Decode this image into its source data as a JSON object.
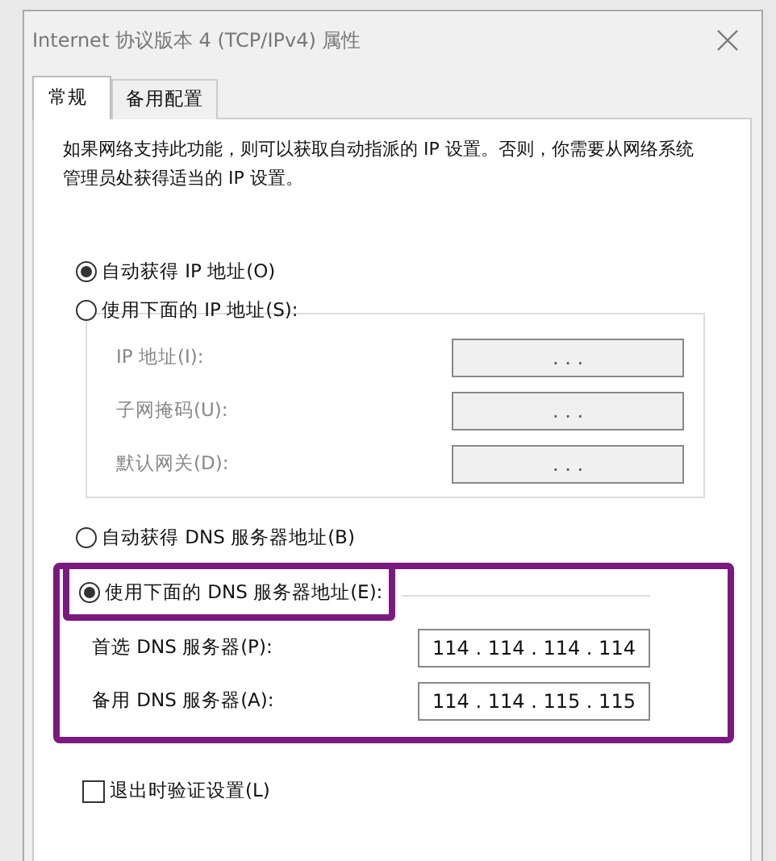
{
  "window": {
    "title": "Internet 协议版本 4 (TCP/IPv4) 属性"
  },
  "tabs": [
    {
      "label": "常规",
      "selected": true
    },
    {
      "label": "备用配置",
      "selected": false
    }
  ],
  "description": "如果网络支持此功能，则可以获取自动指派的 IP 设置。否则，你需要从网络系统管理员处获得适当的 IP 设置。",
  "ip": {
    "options": [
      {
        "label": "自动获得 IP 地址(O)",
        "selected": true
      },
      {
        "label": "使用下面的 IP 地址(S):",
        "selected": false
      }
    ],
    "fields": [
      {
        "label": "IP 地址(I):",
        "disabled": true,
        "value": ". . ."
      },
      {
        "label": "子网掩码(U):",
        "disabled": true,
        "value": ". . ."
      },
      {
        "label": "默认网关(D):",
        "disabled": true,
        "value": ". . ."
      }
    ]
  },
  "dns": {
    "options": [
      {
        "label": "自动获得 DNS 服务器地址(B)",
        "selected": false
      },
      {
        "label": "使用下面的 DNS 服务器地址(E):",
        "selected": true
      }
    ],
    "highlighted": true,
    "fields": [
      {
        "label": "首选 DNS 服务器(P):",
        "disabled": false,
        "value": "114 . 114 . 114 . 114"
      },
      {
        "label": "备用 DNS 服务器(A):",
        "disabled": false,
        "value": "114 . 114 . 115 . 115"
      }
    ]
  },
  "validate_on_exit": {
    "label": "退出时验证设置(L)",
    "checked": false
  }
}
